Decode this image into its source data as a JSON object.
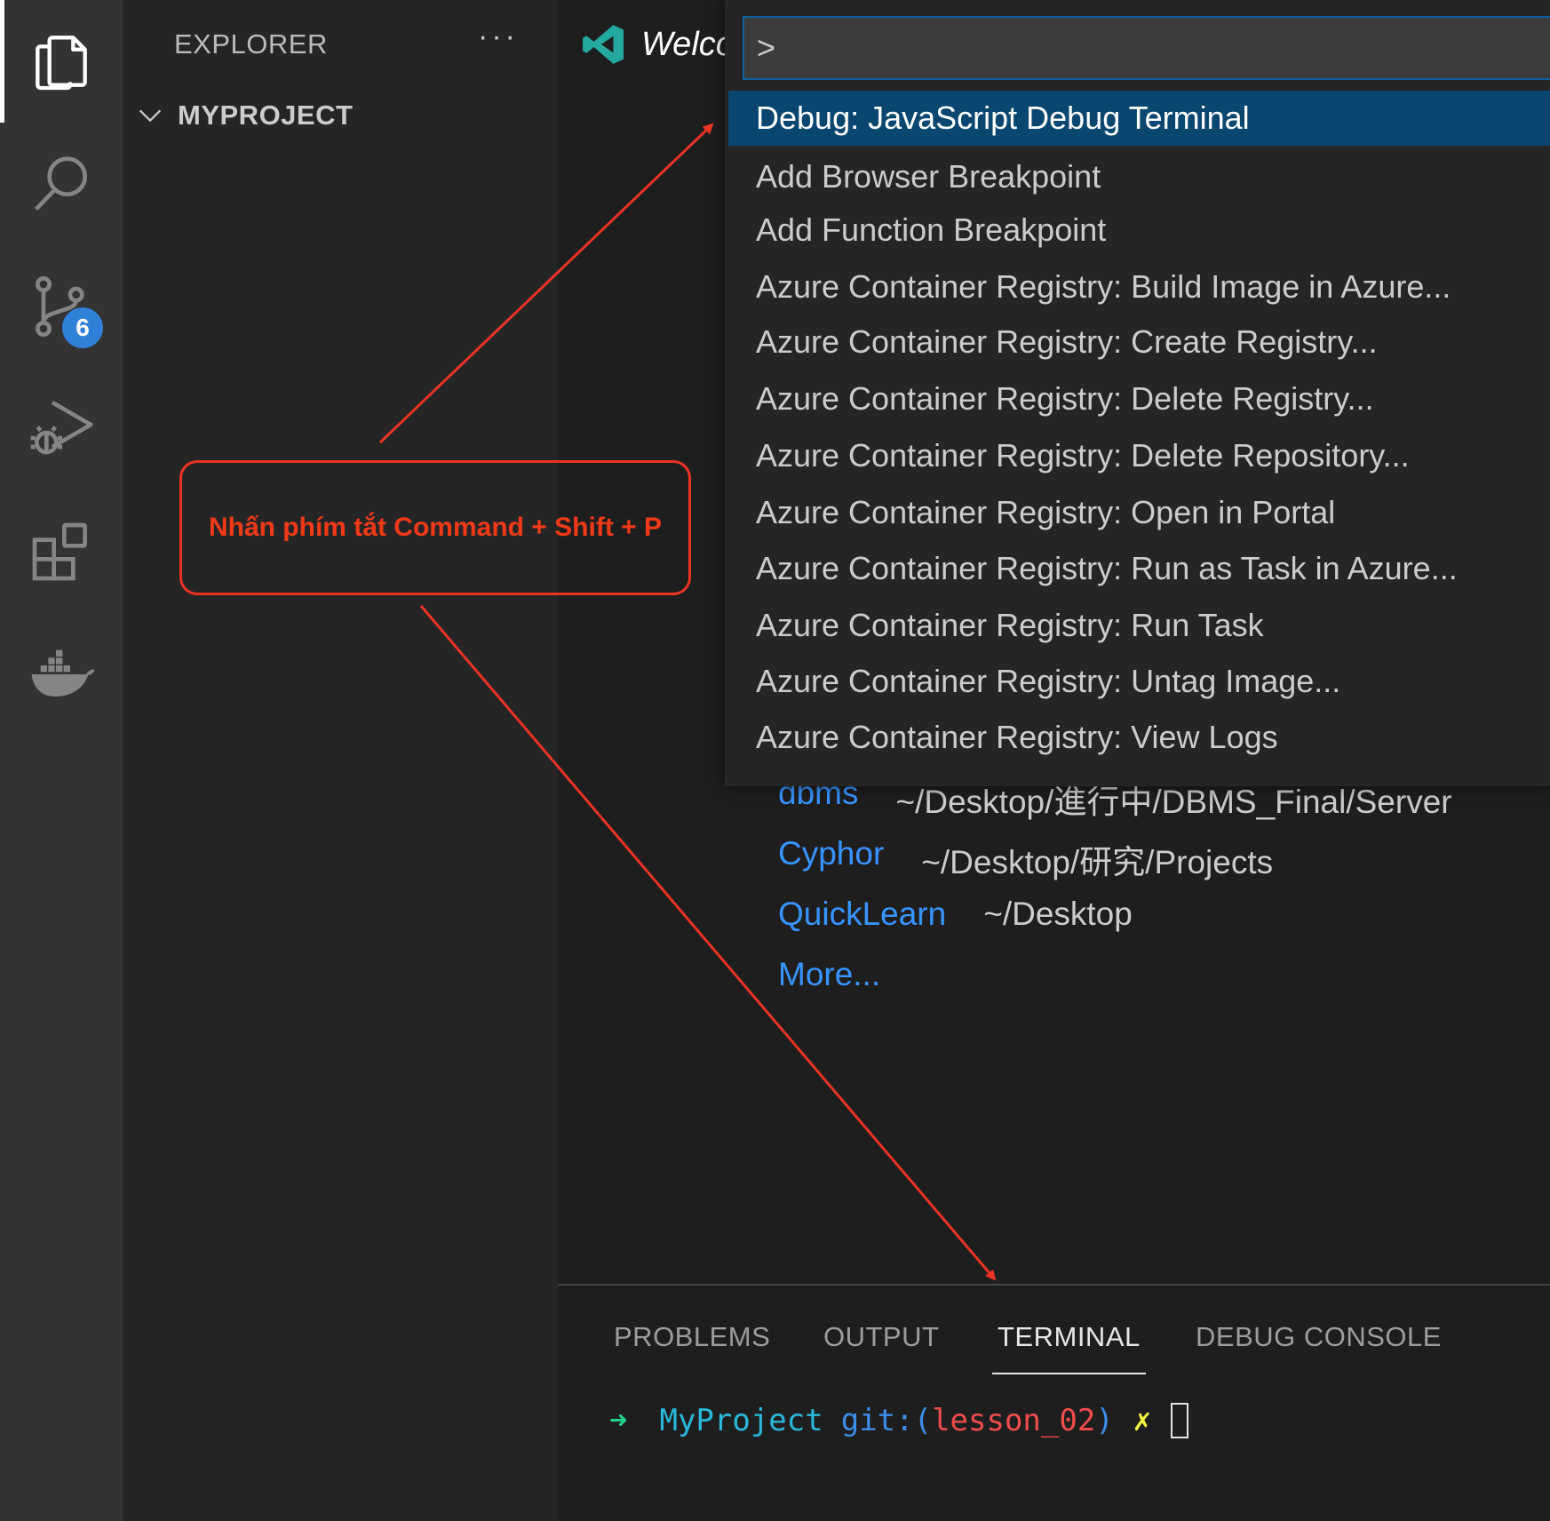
{
  "activity_bar": {
    "items": [
      {
        "icon": "files-icon",
        "active": true
      },
      {
        "icon": "search-icon",
        "active": false
      },
      {
        "icon": "source-control-icon",
        "active": false
      },
      {
        "icon": "run-debug-icon",
        "active": false
      },
      {
        "icon": "extensions-icon",
        "active": false
      },
      {
        "icon": "docker-icon",
        "active": false
      }
    ],
    "source_control_badge": "6"
  },
  "sidebar": {
    "title": "EXPLORER",
    "more_label": "···",
    "project_name": "MYPROJECT"
  },
  "editor": {
    "tab_label": "Welco",
    "recent": [
      {
        "name": "dbms",
        "path": "~/Desktop/進行中/DBMS_Final/Server"
      },
      {
        "name": "Cyphor",
        "path": "~/Desktop/研究/Projects"
      },
      {
        "name": "QuickLearn",
        "path": "~/Desktop"
      }
    ],
    "more_label": "More..."
  },
  "command_palette": {
    "input_value": ">",
    "items": [
      "Debug: JavaScript Debug Terminal",
      "Add Browser Breakpoint",
      "Add Function Breakpoint",
      "Azure Container Registry: Build Image in Azure...",
      "Azure Container Registry: Create Registry...",
      "Azure Container Registry: Delete Registry...",
      "Azure Container Registry: Delete Repository...",
      "Azure Container Registry: Open in Portal",
      "Azure Container Registry: Run as Task in Azure...",
      "Azure Container Registry: Run Task",
      "Azure Container Registry: Untag Image...",
      "Azure Container Registry: View Logs"
    ],
    "selected_index": 0
  },
  "panel": {
    "tabs": [
      "PROBLEMS",
      "OUTPUT",
      "TERMINAL",
      "DEBUG CONSOLE"
    ],
    "active_tab": "TERMINAL",
    "terminal": {
      "arrow": "➜",
      "dir": "MyProject",
      "git_prefix": "git:(",
      "branch": "lesson_02",
      "git_suffix": ")",
      "dirty_mark": "✗"
    }
  },
  "annotation": {
    "text": "Nhấn phím tắt Command + Shift + P",
    "color": "#ea3323"
  },
  "colors": {
    "accent": "#094771",
    "link": "#3794ff",
    "badge": "#2f80d8"
  }
}
